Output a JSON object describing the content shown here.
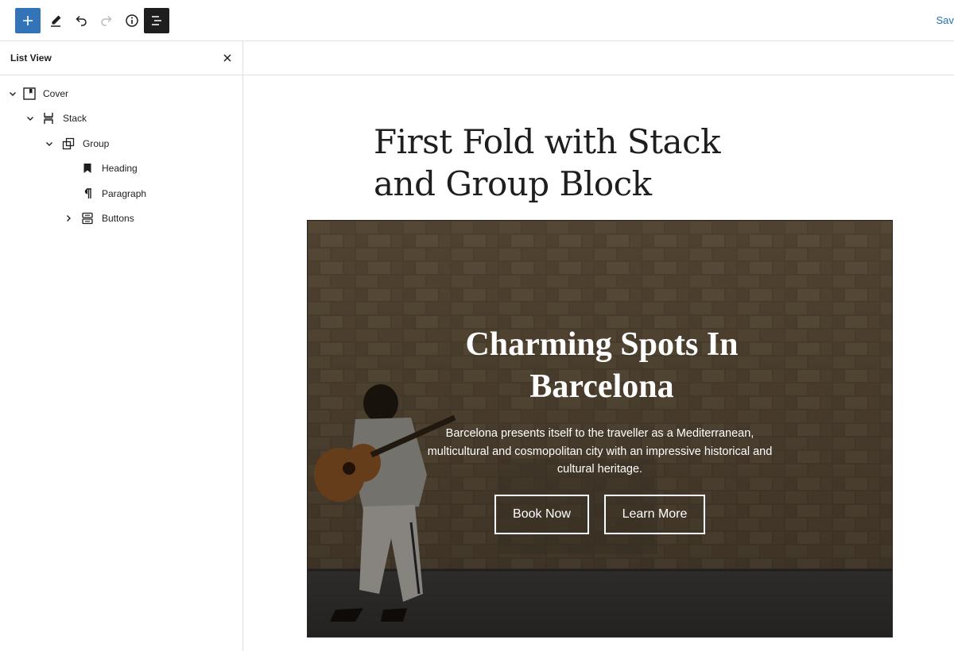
{
  "toolbar": {
    "add_icon": "plus-icon",
    "edit_icon": "pencil-icon",
    "undo_icon": "undo-icon",
    "redo_icon": "redo-icon",
    "info_icon": "info-icon",
    "listview_icon": "list-view-icon",
    "save_label": "Save d",
    "accent_color": "#3373b8"
  },
  "sidebar": {
    "title": "List View",
    "close_icon": "close-icon",
    "items": [
      {
        "label": "Cover",
        "icon": "cover-icon",
        "expanded": true,
        "level": 1
      },
      {
        "label": "Stack",
        "icon": "stack-icon",
        "expanded": true,
        "level": 2
      },
      {
        "label": "Group",
        "icon": "group-icon",
        "expanded": true,
        "level": 3
      },
      {
        "label": "Heading",
        "icon": "bookmark-icon",
        "expanded": null,
        "level": 4
      },
      {
        "label": "Paragraph",
        "icon": "pilcrow-icon",
        "expanded": null,
        "level": 4
      },
      {
        "label": "Buttons",
        "icon": "buttons-icon",
        "expanded": false,
        "level": 4
      }
    ]
  },
  "editor": {
    "page_heading": "First Fold with Stack and Group Block",
    "cover": {
      "heading": "Charming Spots In Barcelona",
      "paragraph": "Barcelona presents itself to the traveller as a Mediterranean, multicultural and cosmopolitan city with an impressive historical and cultural heritage.",
      "buttons": [
        {
          "label": "Book Now"
        },
        {
          "label": "Learn More"
        }
      ]
    }
  }
}
